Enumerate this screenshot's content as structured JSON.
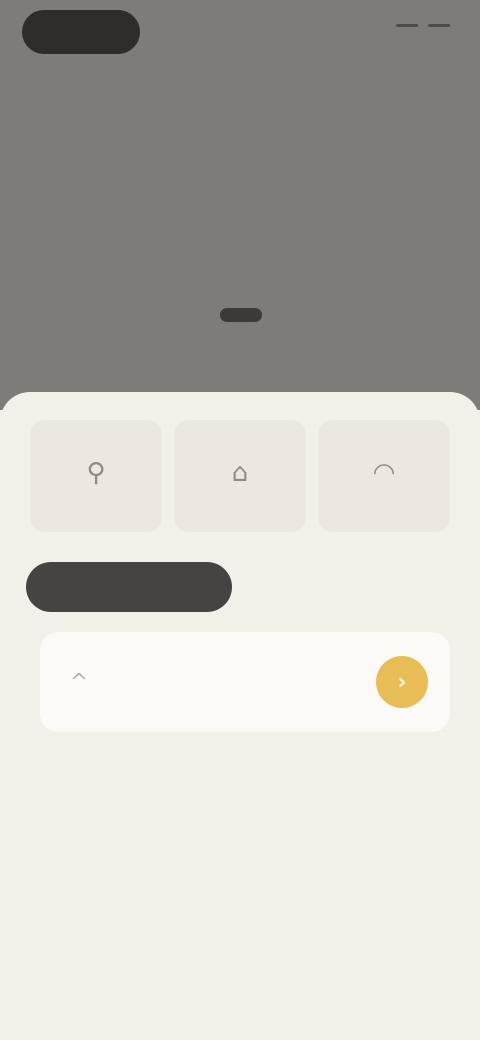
{
  "header": {
    "logo_text": "",
    "title": "",
    "subtitle": ""
  },
  "quick_actions": [
    {
      "icon": "person-icon",
      "glyph": "⚲",
      "label": ""
    },
    {
      "icon": "home-icon",
      "glyph": "⌂",
      "label": ""
    },
    {
      "icon": "bag-icon",
      "glyph": "◠",
      "label": ""
    }
  ],
  "tabs": {
    "active_label": "",
    "inactive_label": ""
  },
  "item": {
    "icon": "chevron-up-icon",
    "glyph": "^",
    "title": "",
    "subtitle": "",
    "action_icon": "arrow-icon",
    "action_glyph": "›"
  },
  "colors": {
    "hero_bg": "#7d7c78",
    "sheet_bg": "#f3f0e9",
    "accent": "#e9bd55",
    "tab_active": "#454442"
  }
}
